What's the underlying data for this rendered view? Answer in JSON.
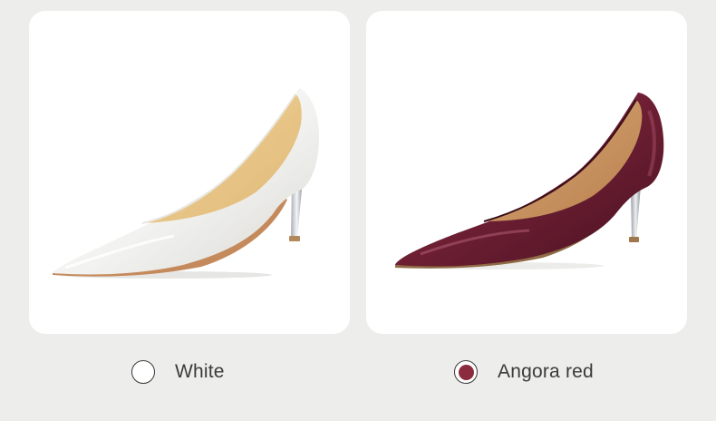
{
  "products": [
    {
      "name": "White",
      "image_icon": "white-pointed-toe-pump-icon",
      "swatch_color": "#ffffff",
      "selected": false
    },
    {
      "name": "Angora red",
      "image_icon": "angora-red-pointed-toe-pump-icon",
      "swatch_color": "#8a2c3d",
      "selected": true
    }
  ],
  "colors": {
    "background": "#ededeb",
    "card": "#ffffff",
    "text": "#3b3b3b",
    "angora_red": "#8a2c3d"
  }
}
